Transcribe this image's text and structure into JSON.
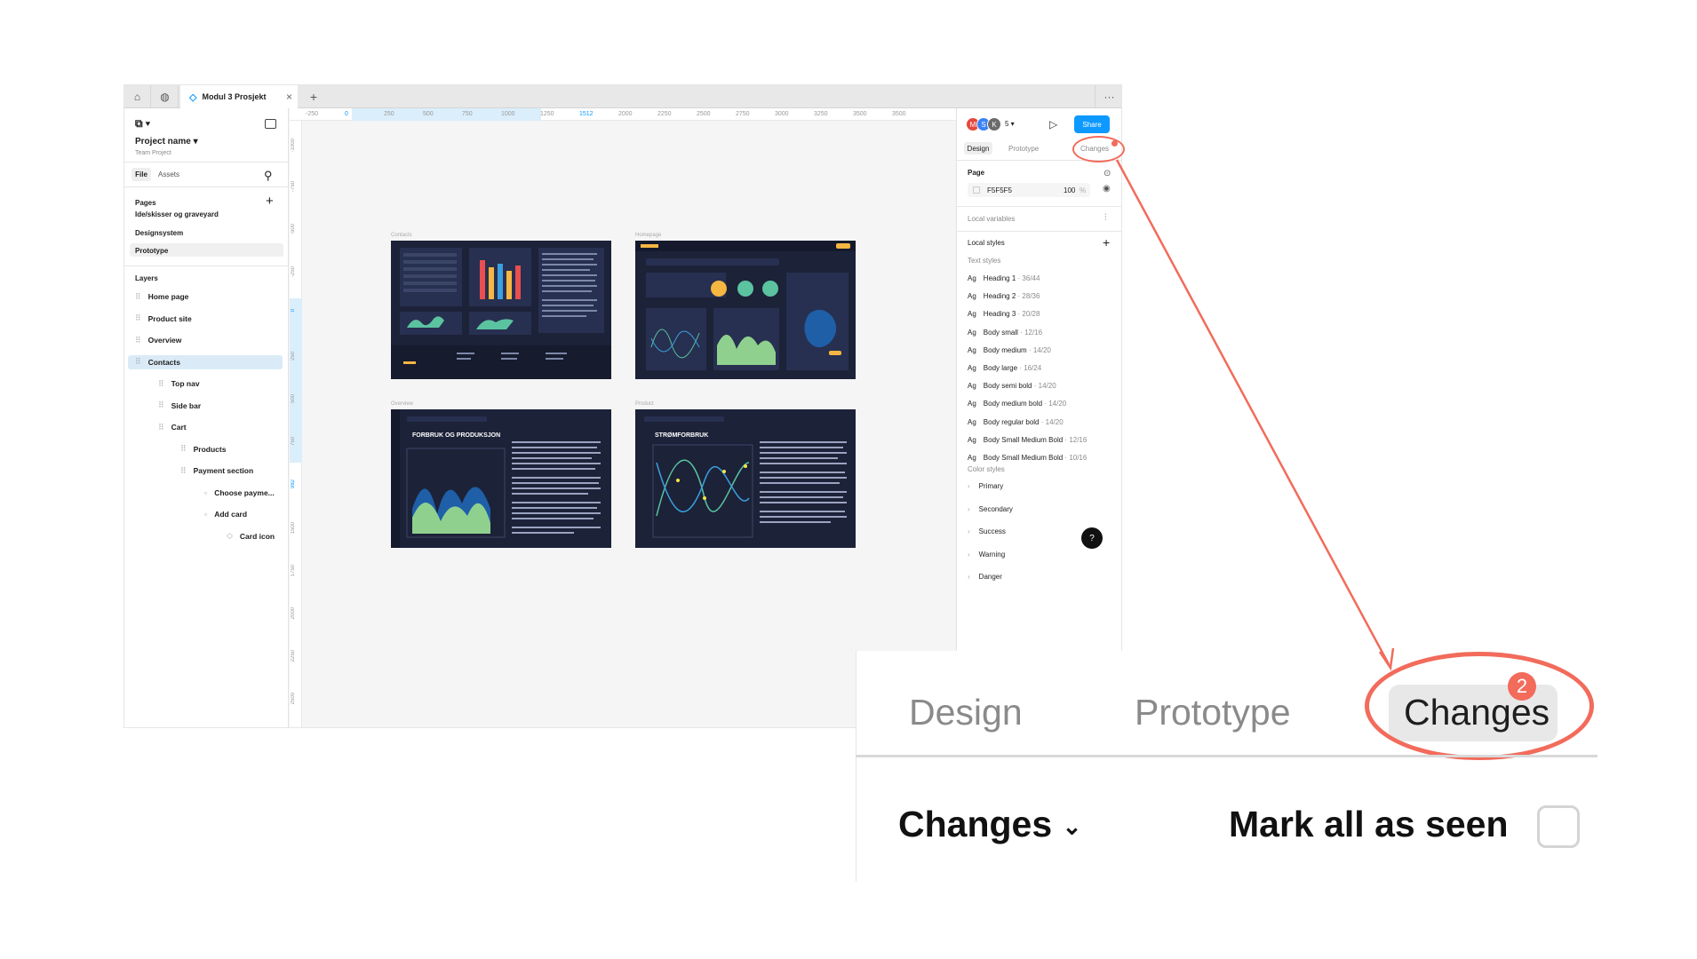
{
  "tabbar": {
    "file_name": "Modul 3 Prosjekt",
    "close": "×",
    "new_tab": "+",
    "more": "···"
  },
  "left_panel": {
    "project_name": "Project name",
    "team": "Team Project",
    "tabs": [
      "File",
      "Assets"
    ],
    "pages_title": "Pages",
    "pages": [
      "Ide/skisser og graveyard",
      "Designsystem",
      "Prototype"
    ],
    "layers_title": "Layers",
    "layers": [
      {
        "label": "Home page",
        "indent": 0
      },
      {
        "label": "Product site",
        "indent": 0
      },
      {
        "label": "Overview",
        "indent": 0
      },
      {
        "label": "Contacts",
        "indent": 0,
        "selected": true
      },
      {
        "label": "Top nav",
        "indent": 1
      },
      {
        "label": "Side bar",
        "indent": 1
      },
      {
        "label": "Cart",
        "indent": 1
      },
      {
        "label": "Products",
        "indent": 2
      },
      {
        "label": "Payment section",
        "indent": 2
      },
      {
        "label": "Choose payme...",
        "indent": 3
      },
      {
        "label": "Add card",
        "indent": 3
      },
      {
        "label": "Card icon",
        "indent": 4
      }
    ]
  },
  "ruler": {
    "top": [
      "-250",
      "0",
      "250",
      "500",
      "750",
      "1000",
      "1250",
      "1512",
      "2000",
      "2250",
      "2500",
      "2750",
      "3000",
      "3250",
      "3500",
      "3500"
    ],
    "left": [
      "-1000",
      "-750",
      "-500",
      "-250",
      "0",
      "250",
      "500",
      "750",
      "982",
      "1500",
      "1750",
      "2000",
      "2250",
      "2500"
    ]
  },
  "canvas": {
    "frames": [
      {
        "label": "Contacts",
        "title": ""
      },
      {
        "label": "Homepage",
        "title": ""
      },
      {
        "label": "Overview",
        "title": "FORBRUK OG PRODUKSJON"
      },
      {
        "label": "Product",
        "title": "STRØMFORBRUK"
      }
    ]
  },
  "right_panel": {
    "avatars": [
      "M",
      "S",
      "K"
    ],
    "avatar_count": "5",
    "share": "Share",
    "tabs": [
      "Design",
      "Prototype",
      "Changes"
    ],
    "page_title": "Page",
    "page_color": "F5F5F5",
    "page_opacity": "100",
    "percent": "%",
    "local_variables": "Local variables",
    "local_styles": "Local styles",
    "text_styles_title": "Text styles",
    "text_styles": [
      {
        "name": "Heading 1",
        "spec": "36/44"
      },
      {
        "name": "Heading 2",
        "spec": "28/36"
      },
      {
        "name": "Heading 3",
        "spec": "20/28"
      },
      {
        "name": "Body small",
        "spec": "12/16"
      },
      {
        "name": "Body medium",
        "spec": "14/20"
      },
      {
        "name": "Body large",
        "spec": "16/24"
      },
      {
        "name": "Body semi bold",
        "spec": "14/20"
      },
      {
        "name": "Body medium bold",
        "spec": "14/20"
      },
      {
        "name": "Body regular bold",
        "spec": "14/20"
      },
      {
        "name": "Body Small Medium Bold",
        "spec": "12/16"
      },
      {
        "name": "Body Small Medium Bold",
        "spec": "10/16"
      }
    ],
    "ag": "Ag",
    "color_styles_title": "Color styles",
    "color_styles": [
      "Primary",
      "Secondary",
      "Success",
      "Warning",
      "Danger"
    ],
    "help": "?"
  },
  "zoom": {
    "tabs": [
      "Design",
      "Prototype",
      "Changes"
    ],
    "badge": "2",
    "changes_title": "Changes",
    "mark_all": "Mark all as seen"
  },
  "colors": {
    "accent": "#0d99ff",
    "annotation": "#f26b5b",
    "frame_bg": "#1c2238",
    "selected_layer": "#daebf7"
  }
}
